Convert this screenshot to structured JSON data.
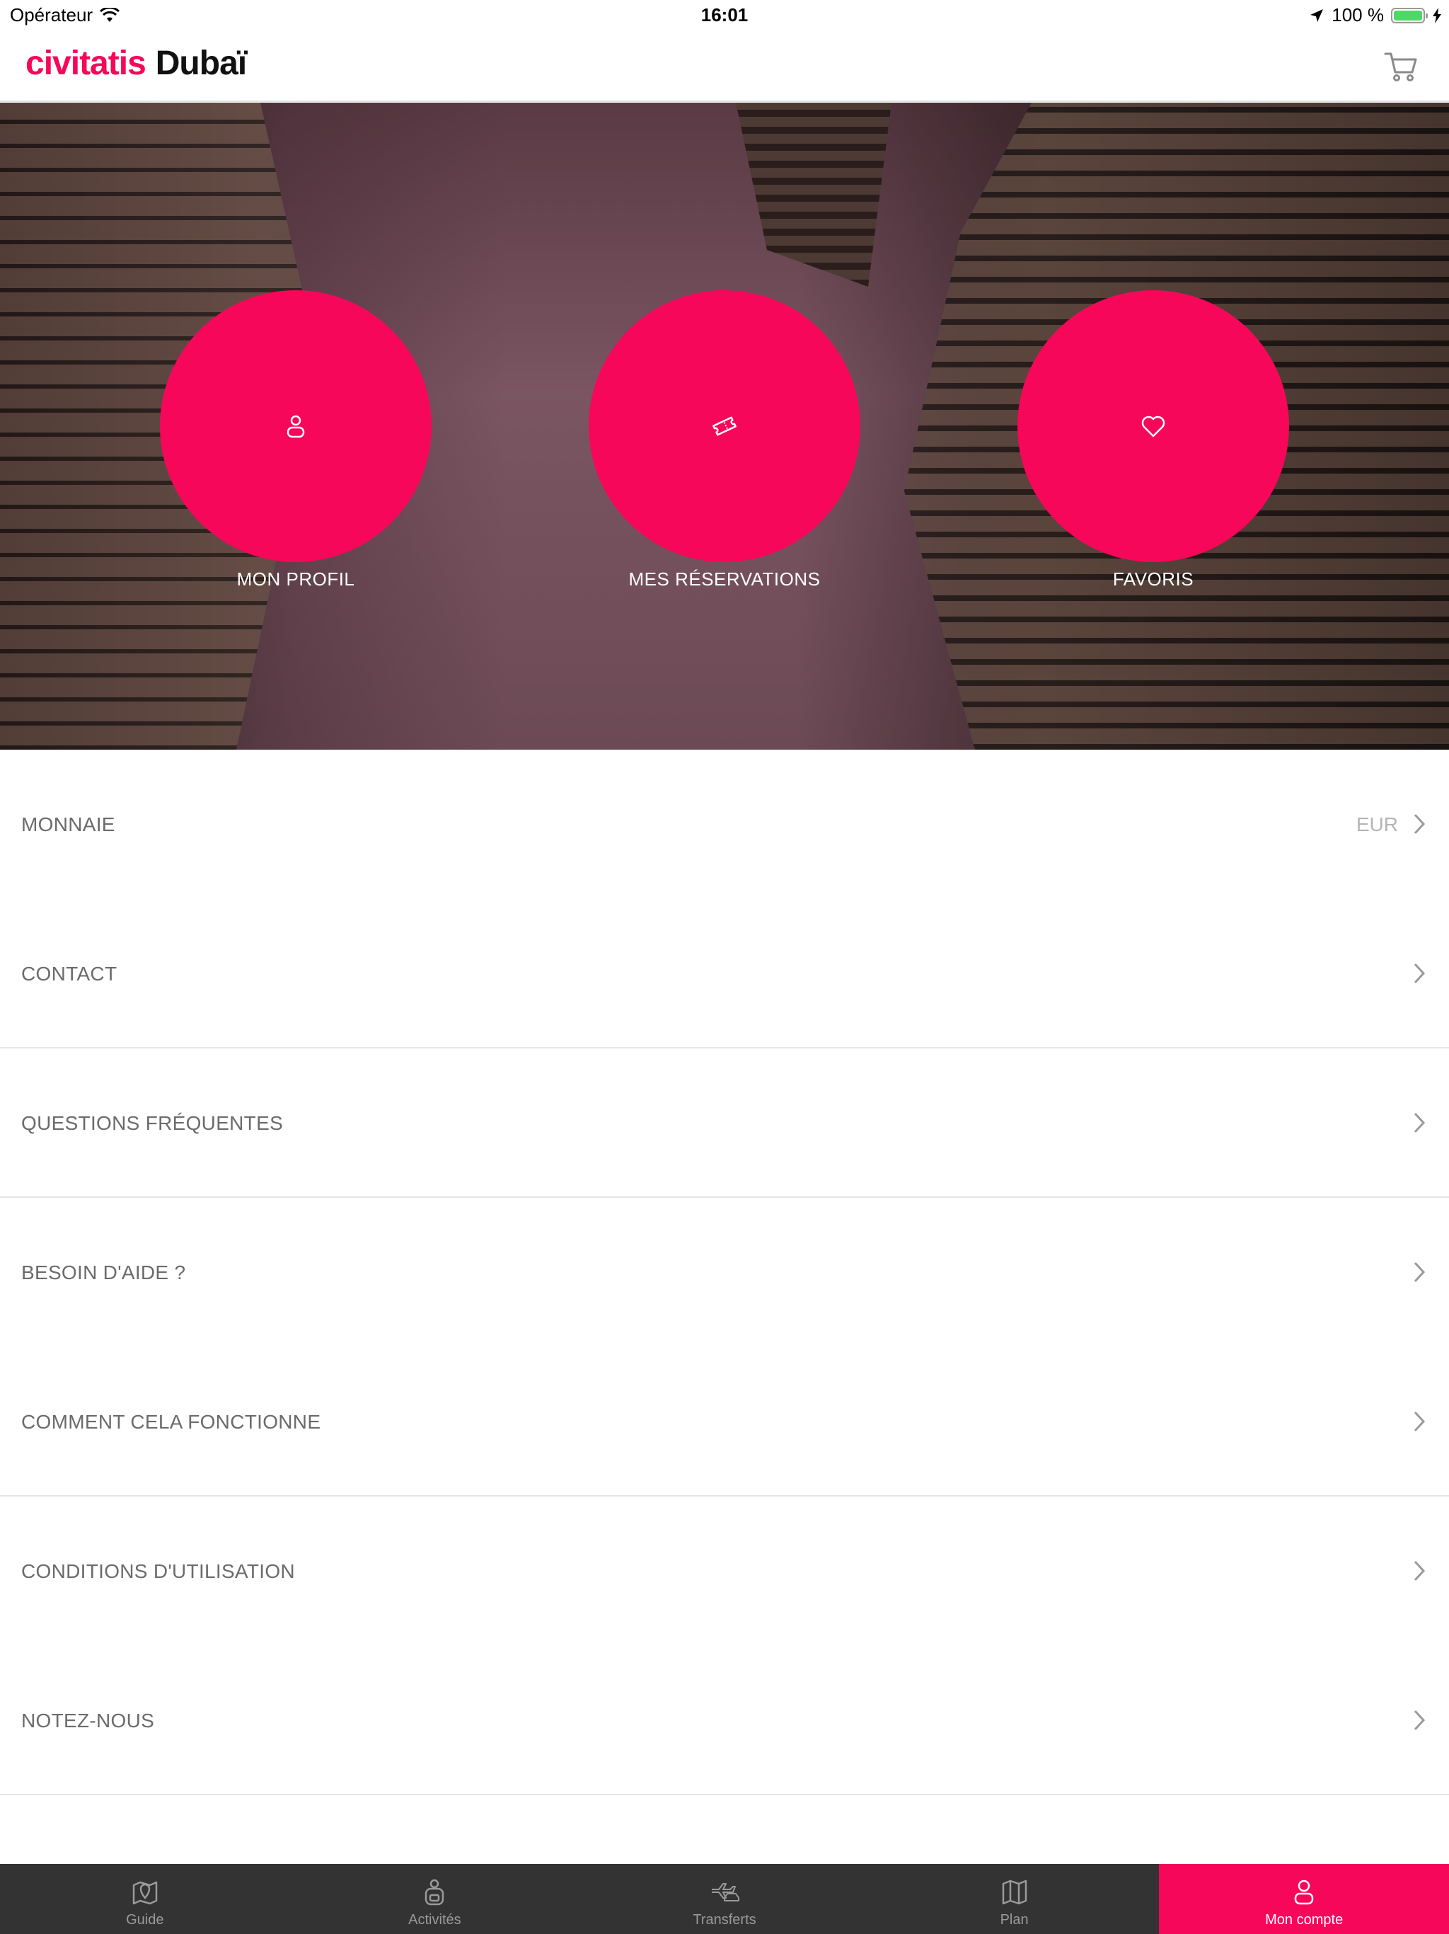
{
  "status_bar": {
    "carrier": "Opérateur",
    "time": "16:01",
    "battery_percent": "100 %",
    "battery_level": 1.0
  },
  "header": {
    "brand": "civitatis",
    "city": "Dubaï",
    "cart_icon": "cart-icon"
  },
  "colors": {
    "accent": "#f70759",
    "tabbar_bg": "#333333"
  },
  "hero": {
    "buttons": [
      {
        "label": "MON PROFIL",
        "icon": "user-icon"
      },
      {
        "label": "MES RÉSERVATIONS",
        "icon": "ticket-icon"
      },
      {
        "label": "FAVORIS",
        "icon": "heart-icon"
      }
    ]
  },
  "menu": {
    "items": [
      {
        "label": "MONNAIE",
        "value": "EUR"
      },
      {
        "label": "CONTACT"
      },
      {
        "label": "QUESTIONS FRÉQUENTES"
      },
      {
        "label": "BESOIN D'AIDE ?"
      },
      {
        "label": "COMMENT CELA FONCTIONNE"
      },
      {
        "label": "CONDITIONS D'UTILISATION"
      },
      {
        "label": "NOTEZ-NOUS"
      }
    ]
  },
  "tabbar": {
    "tabs": [
      {
        "label": "Guide",
        "icon": "map-marker-icon"
      },
      {
        "label": "Activités",
        "icon": "backpack-icon"
      },
      {
        "label": "Transferts",
        "icon": "plane-car-icon"
      },
      {
        "label": "Plan",
        "icon": "folded-map-icon"
      },
      {
        "label": "Mon compte",
        "icon": "user-icon",
        "active": true
      }
    ]
  }
}
